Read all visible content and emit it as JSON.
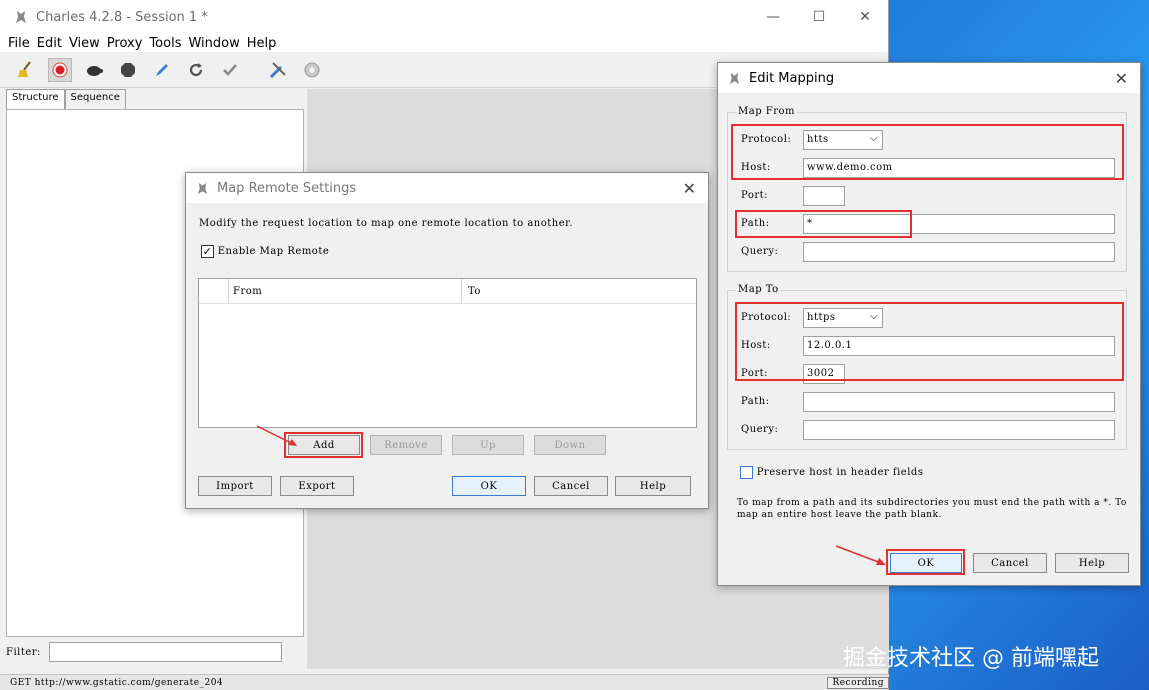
{
  "window": {
    "title": "Charles 4.2.8 - Session 1 *",
    "minimize": "—",
    "maximize": "☐",
    "close": "✕"
  },
  "menu": [
    "File",
    "Edit",
    "View",
    "Proxy",
    "Tools",
    "Window",
    "Help"
  ],
  "toolbar_icons": [
    "broom-icon",
    "record-icon",
    "turtle-icon",
    "stop-icon",
    "pen-icon",
    "refresh-icon",
    "check-icon",
    "tools-icon",
    "gear-icon"
  ],
  "left_tabs": [
    "Structure",
    "Sequence"
  ],
  "filter": {
    "label": "Filter:",
    "value": ""
  },
  "status": {
    "text": "GET http://www.gstatic.com/generate_204",
    "recording": "Recording"
  },
  "map_remote": {
    "title": "Map Remote Settings",
    "description": "Modify the request location to map one remote location to another.",
    "enable_label": "Enable Map Remote",
    "enabled": true,
    "columns": [
      "From",
      "To"
    ],
    "buttons": {
      "add": "Add",
      "remove": "Remove",
      "up": "Up",
      "down": "Down",
      "import": "Import",
      "export": "Export",
      "ok": "OK",
      "cancel": "Cancel",
      "help": "Help"
    }
  },
  "edit_mapping": {
    "title": "Edit Mapping",
    "map_from": {
      "heading": "Map From",
      "protocol_label": "Protocol:",
      "protocol": "htts",
      "host_label": "Host:",
      "host": "www.demo.com",
      "port_label": "Port:",
      "port": "",
      "path_label": "Path:",
      "path": "*",
      "query_label": "Query:",
      "query": ""
    },
    "map_to": {
      "heading": "Map To",
      "protocol_label": "Protocol:",
      "protocol": "https",
      "host_label": "Host:",
      "host": "12.0.0.1",
      "port_label": "Port:",
      "port": "3002",
      "path_label": "Path:",
      "path": "",
      "query_label": "Query:",
      "query": ""
    },
    "preserve_label": "Preserve host in header fields",
    "preserve": false,
    "hint": "To map from a path and its subdirectories you must end the path with a *. To map an entire host leave the path blank.",
    "buttons": {
      "ok": "OK",
      "cancel": "Cancel",
      "help": "Help"
    }
  },
  "watermark": "掘金技术社区 @ 前端嘿起",
  "colors": {
    "highlight": "#e03030",
    "desktop": "#1e78d8"
  }
}
